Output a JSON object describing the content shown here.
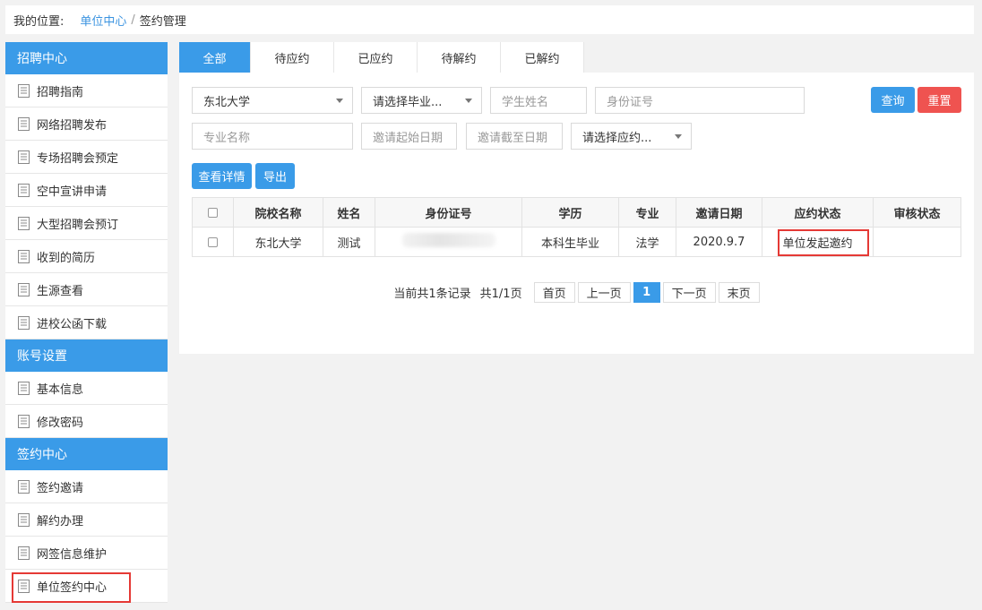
{
  "breadcrumb": {
    "label": "我的位置:",
    "link": "单位中心",
    "sep": "/",
    "current": "签约管理"
  },
  "sidebar": {
    "group1": {
      "title": "招聘中心",
      "items": [
        "招聘指南",
        "网络招聘发布",
        "专场招聘会预定",
        "空中宣讲申请",
        "大型招聘会预订",
        "收到的简历",
        "生源查看",
        "进校公函下载"
      ]
    },
    "group2": {
      "title": "账号设置",
      "items": [
        "基本信息",
        "修改密码"
      ]
    },
    "group3": {
      "title": "签约中心",
      "items": [
        "签约邀请",
        "解约办理",
        "网签信息维护",
        "单位签约中心"
      ]
    }
  },
  "tabs": [
    "全部",
    "待应约",
    "已应约",
    "待解约",
    "已解约"
  ],
  "filters": {
    "school": "东北大学",
    "grad_placeholder": "请选择毕业...",
    "name_placeholder": "学生姓名",
    "id_placeholder": "身份证号",
    "major_placeholder": "专业名称",
    "start_placeholder": "邀请起始日期",
    "end_placeholder": "邀请截至日期",
    "status_placeholder": "请选择应约..."
  },
  "buttons": {
    "query": "查询",
    "reset": "重置",
    "detail": "查看详情",
    "export": "导出"
  },
  "table": {
    "headers": [
      "院校名称",
      "姓名",
      "身份证号",
      "学历",
      "专业",
      "邀请日期",
      "应约状态",
      "审核状态"
    ],
    "rows": [
      {
        "school": "东北大学",
        "name": "测试",
        "id": "",
        "degree": "本科生毕业",
        "major": "法学",
        "date": "2020.9.7",
        "status": "单位发起邀约",
        "audit": ""
      }
    ]
  },
  "pager": {
    "info": "当前共1条记录",
    "pages": "共1/1页",
    "first": "首页",
    "prev": "上一页",
    "current": "1",
    "next": "下一页",
    "last": "末页"
  },
  "colors": {
    "primary": "#3a9be8",
    "danger": "#ef5350",
    "highlight": "#e53935"
  }
}
